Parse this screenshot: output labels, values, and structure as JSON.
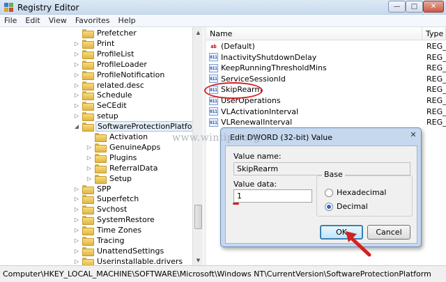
{
  "window": {
    "title": "Registry Editor",
    "minimize": "—",
    "maximize": "□",
    "close": "✕"
  },
  "menu": [
    "File",
    "Edit",
    "View",
    "Favorites",
    "Help"
  ],
  "tree": [
    {
      "label": "Prefetcher",
      "expandable": false
    },
    {
      "label": "Print",
      "expandable": true
    },
    {
      "label": "ProfileList",
      "expandable": true
    },
    {
      "label": "ProfileLoader",
      "expandable": true
    },
    {
      "label": "ProfileNotification",
      "expandable": true
    },
    {
      "label": "related.desc",
      "expandable": true
    },
    {
      "label": "Schedule",
      "expandable": true
    },
    {
      "label": "SeCEdit",
      "expandable": true
    },
    {
      "label": "setup",
      "expandable": true
    },
    {
      "label": "SoftwareProtectionPlatform",
      "expandable": true,
      "expanded": true,
      "selected": true
    },
    {
      "label": "Activation",
      "child": true,
      "expandable": false
    },
    {
      "label": "GenuineApps",
      "child": true,
      "expandable": true
    },
    {
      "label": "Plugins",
      "child": true,
      "expandable": true
    },
    {
      "label": "ReferralData",
      "child": true,
      "expandable": true
    },
    {
      "label": "Setup",
      "child": true,
      "expandable": true
    },
    {
      "label": "SPP",
      "expandable": true
    },
    {
      "label": "Superfetch",
      "expandable": true
    },
    {
      "label": "Svchost",
      "expandable": true
    },
    {
      "label": "SystemRestore",
      "expandable": true
    },
    {
      "label": "Time Zones",
      "expandable": true
    },
    {
      "label": "Tracing",
      "expandable": true
    },
    {
      "label": "UnattendSettings",
      "expandable": true
    },
    {
      "label": "Userinstallable.drivers",
      "expandable": true
    }
  ],
  "list": {
    "columns": {
      "name": "Name",
      "type": "Type"
    },
    "rows": [
      {
        "name": "(Default)",
        "type": "REG_",
        "icon": "string-value-icon"
      },
      {
        "name": "InactivityShutdownDelay",
        "type": "REG_",
        "icon": "binary-value-icon"
      },
      {
        "name": "KeepRunningThresholdMins",
        "type": "REG_",
        "icon": "binary-value-icon"
      },
      {
        "name": "ServiceSessionId",
        "type": "REG_",
        "icon": "binary-value-icon"
      },
      {
        "name": "SkipRearm",
        "type": "REG_",
        "icon": "binary-value-icon"
      },
      {
        "name": "UserOperations",
        "type": "REG_",
        "icon": "binary-value-icon"
      },
      {
        "name": "VLActivationInterval",
        "type": "REG_",
        "icon": "binary-value-icon"
      },
      {
        "name": "VLRenewalInterval",
        "type": "REG_",
        "icon": "binary-value-icon"
      }
    ]
  },
  "status_path": "Computer\\HKEY_LOCAL_MACHINE\\SOFTWARE\\Microsoft\\Windows NT\\CurrentVersion\\SoftwareProtectionPlatform",
  "dialog": {
    "title": "Edit DWORD (32-bit) Value",
    "close": "✕",
    "value_name_label": "Value name:",
    "value_name": "SkipRearm",
    "value_data_label": "Value data:",
    "value_data": "1",
    "base_label": "Base",
    "hex_label": "Hexadecimal",
    "dec_label": "Decimal",
    "base_selected": "Decimal",
    "ok_label": "OK",
    "cancel_label": "Cancel"
  },
  "watermark": "www.wintips.org",
  "annotation_color": "#d62020"
}
